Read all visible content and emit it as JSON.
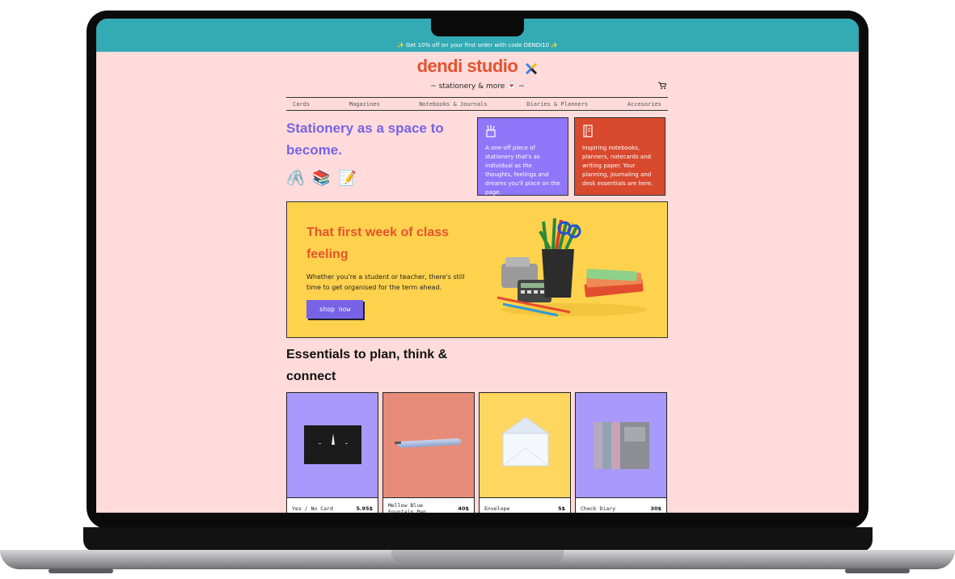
{
  "announcement": "✨ Get 10% off on your first order with code DENDI10 ✨",
  "brand": {
    "name": "dendi studio",
    "tagline": "~ stationery & more 💌 ~"
  },
  "nav": {
    "items": [
      "Cards",
      "Magazines",
      "Notebooks & Journals",
      "Diaries & Planners",
      "Accesories"
    ]
  },
  "hero": {
    "title": "Stationery as a space to become.",
    "emojis": [
      "🖇️",
      "📚",
      "📝"
    ]
  },
  "feature_cards": [
    {
      "text": "A one-off piece of stationery that's as individual as the thoughts, feelings and dreams you'll place on the page.",
      "icon": "pencil-cup-icon",
      "color": "#8f77fa"
    },
    {
      "text": "Inspiring notebooks, planners, notecards and writing paper. Your planning, journaling and desk essentials are here.",
      "icon": "notebook-icon",
      "color": "#d9492e"
    }
  ],
  "banner": {
    "title": "That first week of class feeling",
    "text": "Whether you're a student or teacher, there's still time to get organised for the term ahead.",
    "button": "shop now"
  },
  "section": {
    "title": "Essentials to plan, think & connect"
  },
  "products": [
    {
      "name": "Yes / No Card",
      "price": "5.95$",
      "bg": "#a899fb"
    },
    {
      "name": "Mellow Blue Fountain Pen",
      "price": "40$",
      "bg": "#e88c7a"
    },
    {
      "name": "Envelope",
      "price": "5$",
      "bg": "#ffd660"
    },
    {
      "name": "Check Diary",
      "price": "30$",
      "bg": "#a899fb"
    }
  ],
  "colors": {
    "accent_purple": "#7763e6",
    "accent_red": "#e4532f",
    "banner_yellow": "#ffd24d",
    "teal": "#33aab4",
    "page_pink": "#ffdbdb"
  }
}
